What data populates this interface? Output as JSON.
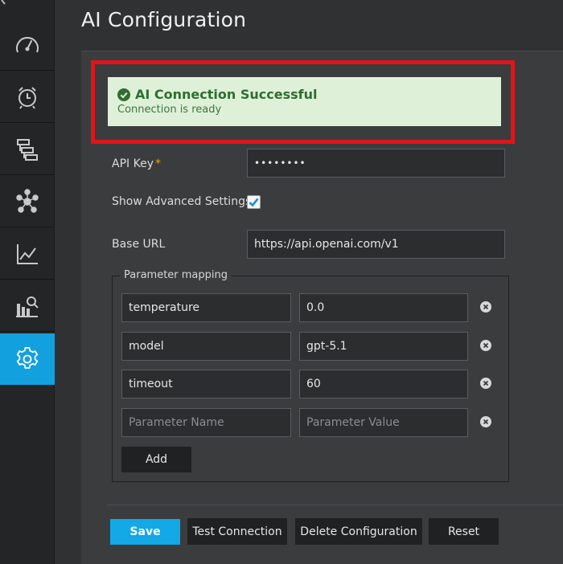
{
  "page": {
    "title": "AI Configuration"
  },
  "sidebar": {
    "items": [
      {
        "icon": "speedometer-icon"
      },
      {
        "icon": "alarm-clock-icon"
      },
      {
        "icon": "hierarchy-icon"
      },
      {
        "icon": "network-icon"
      },
      {
        "icon": "line-chart-icon"
      },
      {
        "icon": "report-search-icon"
      },
      {
        "icon": "gear-icon",
        "active": true
      }
    ]
  },
  "banner": {
    "title": "AI Connection Successful",
    "subtitle": "Connection is ready",
    "color": "#dff0d8"
  },
  "form": {
    "api_key_label": "API Key",
    "api_key_required": "*",
    "api_key_value": "••••••••",
    "advanced_label": "Show Advanced Settings",
    "advanced_checked": true,
    "base_url_label": "Base URL",
    "base_url_value": "https://api.openai.com/v1"
  },
  "params": {
    "legend": "Parameter mapping",
    "rows": [
      {
        "name": "temperature",
        "value": "0.0"
      },
      {
        "name": "model",
        "value": "gpt-5.1"
      },
      {
        "name": "timeout",
        "value": "60"
      }
    ],
    "name_placeholder": "Parameter Name",
    "value_placeholder": "Parameter Value",
    "add_label": "Add"
  },
  "actions": {
    "save": "Save",
    "test": "Test Connection",
    "delete": "Delete Configuration",
    "reset": "Reset",
    "accent": "#13a8e6"
  }
}
